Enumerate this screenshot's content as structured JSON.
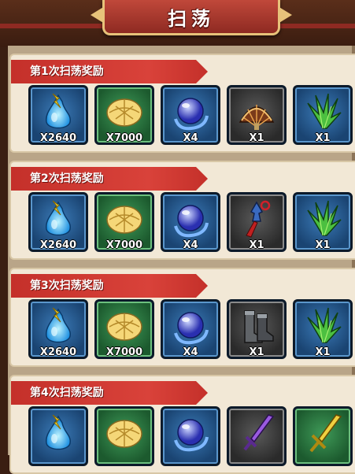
{
  "header": {
    "title": "扫荡"
  },
  "sections": [
    {
      "title": "第1次扫荡奖励",
      "items": [
        {
          "icon": "blue-flame-potion-icon",
          "qty": "X2640",
          "frame": "blue"
        },
        {
          "icon": "golden-leaf-icon",
          "qty": "X7000",
          "frame": "green"
        },
        {
          "icon": "blue-orb-icon",
          "qty": "X4",
          "frame": "blue"
        },
        {
          "icon": "feather-fan-icon",
          "qty": "X1",
          "frame": "grey"
        },
        {
          "icon": "green-herb-icon",
          "qty": "X1",
          "frame": "blue"
        }
      ]
    },
    {
      "title": "第2次扫荡奖励",
      "items": [
        {
          "icon": "blue-flame-potion-icon",
          "qty": "X2640",
          "frame": "blue"
        },
        {
          "icon": "golden-leaf-icon",
          "qty": "X7000",
          "frame": "green"
        },
        {
          "icon": "blue-orb-icon",
          "qty": "X4",
          "frame": "blue"
        },
        {
          "icon": "tassel-pendant-icon",
          "qty": "X1",
          "frame": "grey"
        },
        {
          "icon": "green-herb-icon",
          "qty": "X1",
          "frame": "blue"
        }
      ]
    },
    {
      "title": "第3次扫荡奖励",
      "items": [
        {
          "icon": "blue-flame-potion-icon",
          "qty": "X2640",
          "frame": "blue"
        },
        {
          "icon": "golden-leaf-icon",
          "qty": "X7000",
          "frame": "green"
        },
        {
          "icon": "blue-orb-icon",
          "qty": "X4",
          "frame": "blue"
        },
        {
          "icon": "boots-icon",
          "qty": "X1",
          "frame": "grey"
        },
        {
          "icon": "green-herb-icon",
          "qty": "X1",
          "frame": "blue"
        }
      ]
    },
    {
      "title": "第4次扫荡奖励",
      "items": [
        {
          "icon": "blue-flame-potion-icon",
          "qty": "",
          "frame": "blue"
        },
        {
          "icon": "golden-leaf-icon",
          "qty": "",
          "frame": "green"
        },
        {
          "icon": "blue-orb-icon",
          "qty": "",
          "frame": "blue"
        },
        {
          "icon": "purple-sword-icon",
          "qty": "",
          "frame": "grey"
        },
        {
          "icon": "golden-sword-icon",
          "qty": "",
          "frame": "green"
        }
      ]
    }
  ],
  "colors": {
    "banner": "#c4302a",
    "section_bg": "#f2e8d6",
    "blue_frame": "#1a4472",
    "green_frame": "#1c5a2e",
    "grey_frame": "#2a2a2a"
  }
}
